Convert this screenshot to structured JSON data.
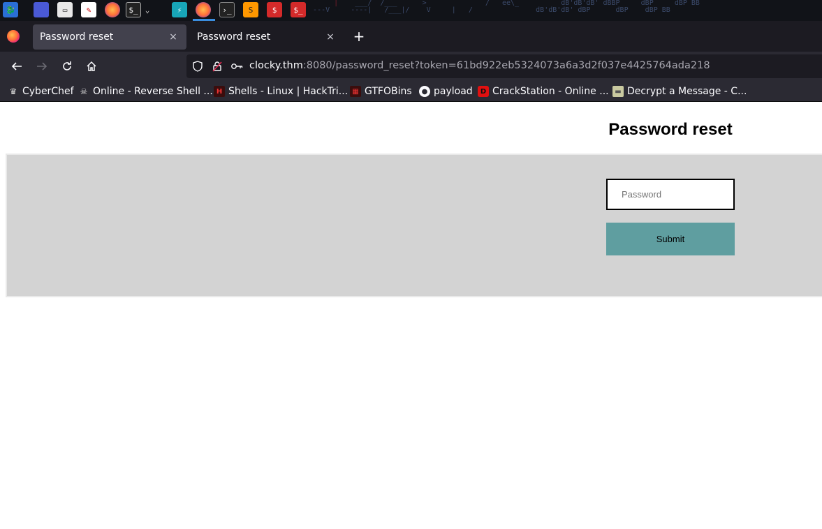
{
  "browser": {
    "tabs": [
      {
        "title": "Password reset",
        "close": "×"
      },
      {
        "title": "Password reset",
        "close": "×"
      }
    ],
    "new_tab": "+",
    "url": {
      "host": "clocky.thm",
      "rest": ":8080/password_reset?token=61bd922eb5324073a6a3d2f037e4425764ada218"
    },
    "bookmarks": [
      {
        "label": "CyberChef",
        "icon": "chef-hat-icon"
      },
      {
        "label": "Online - Reverse Shell ...",
        "icon": "skull-icon"
      },
      {
        "label": "Shells - Linux | HackTri...",
        "icon": "hacktricks-icon"
      },
      {
        "label": "GTFOBins",
        "icon": "gtfobins-icon"
      },
      {
        "label": "payload",
        "icon": "github-icon"
      },
      {
        "label": "CrackStation - Online ...",
        "icon": "crackstation-icon"
      },
      {
        "label": "Decrypt a Message - C...",
        "icon": "cryptii-icon"
      }
    ]
  },
  "page": {
    "title": "Password reset",
    "password_placeholder": "Password",
    "submit_label": "Submit"
  },
  "colors": {
    "form_panel": "#d3d3d3",
    "submit_button": "#5f9ea0",
    "tab_selected": "#42414d",
    "toolbar": "#2b2a33"
  }
}
